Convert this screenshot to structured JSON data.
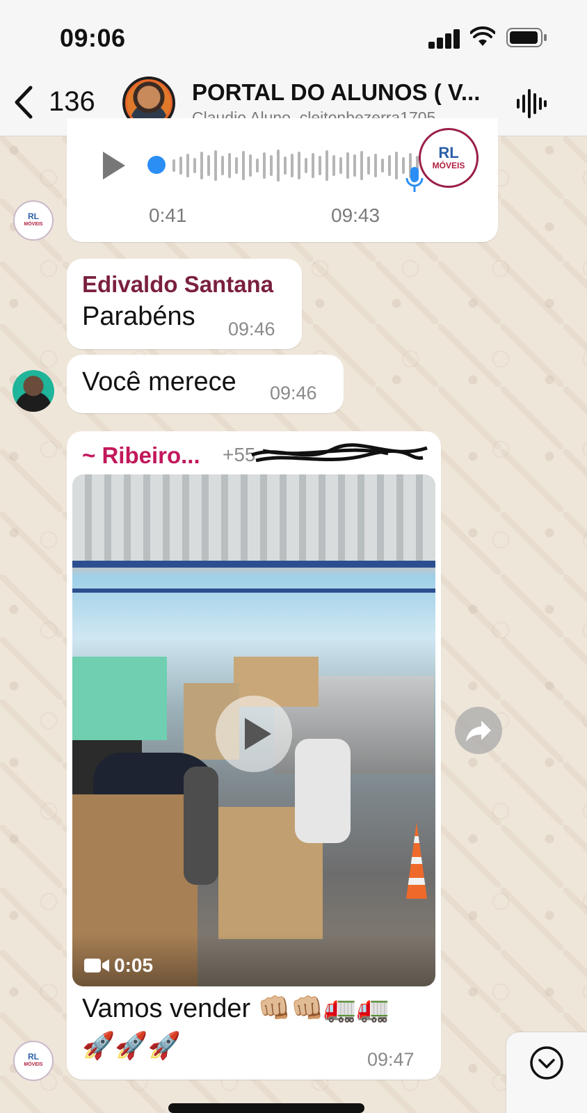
{
  "status_bar": {
    "time": "09:06"
  },
  "header": {
    "back_count": "136",
    "group_title": "PORTAL DO ALUNOS ( V...",
    "group_members": "Claudio Aluno, cleitonbezerra1705..."
  },
  "messages": [
    {
      "type": "audio",
      "duration": "0:41",
      "time": "09:43",
      "profile_logo_text": "RL",
      "profile_logo_sub": "MÓVEIS"
    },
    {
      "type": "text",
      "sender": "Edivaldo Santana",
      "sender_color": "#7a1f3d",
      "text": "Parabéns",
      "time": "09:46"
    },
    {
      "type": "text",
      "text": "Você merece",
      "time": "09:46"
    },
    {
      "type": "video",
      "sender": "~ Ribeiro...",
      "sender_color": "#c2185b",
      "phone": "+55",
      "duration": "0:05",
      "caption_line1": "Vamos  vender 👊🏼👊🏼🚛🚛",
      "caption_line2": "🚀🚀🚀",
      "time": "09:47"
    }
  ],
  "avatar_logo": {
    "text": "RL",
    "sub": "MÓVEIS"
  },
  "colors": {
    "accent_blue": "#2a8ef5",
    "wallpaper": "#efe6da"
  }
}
